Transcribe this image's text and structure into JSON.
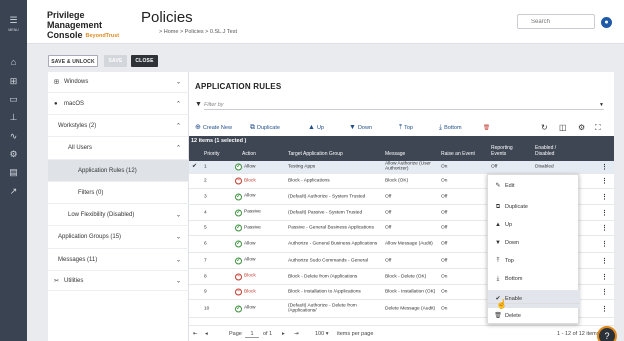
{
  "rail": {
    "menu_label": "MENU",
    "icons": [
      "home-icon",
      "hierarchy-icon",
      "monitor-icon",
      "org-chart-icon",
      "analytics-icon",
      "gears-icon",
      "clipboard-icon",
      "user-link-icon"
    ]
  },
  "header": {
    "brand_line1": "Privilege Management",
    "brand_line2": "Console",
    "brand_badge": "BeyondTrust",
    "title": "Policies",
    "breadcrumb": "> Home > Policies > 0.SL.J Test",
    "search_placeholder": "Search",
    "avatar_icon": "user-icon"
  },
  "toolbar": {
    "save_unlock": "SAVE & UNLOCK",
    "save": "SAVE",
    "close": "CLOSE"
  },
  "sidebar": {
    "items": [
      {
        "label": "Windows",
        "icon": "windows-icon",
        "chev": "⌄"
      },
      {
        "label": "macOS",
        "icon": "apple-icon",
        "chev": "⌃"
      },
      {
        "label": "Workstyles (2)",
        "chev": "⌃"
      },
      {
        "label": "All Users",
        "chev": "⌃"
      },
      {
        "label": "Application Rules (12)",
        "chev": ""
      },
      {
        "label": "Filters (0)",
        "chev": ""
      },
      {
        "label": "Low Flexibility (Disabled)",
        "chev": "⌄"
      },
      {
        "label": "Application Groups (15)",
        "chev": "⌄"
      },
      {
        "label": "Messages (11)",
        "chev": "⌄"
      },
      {
        "label": "Utilities",
        "icon": "tools-icon",
        "chev": "⌄"
      }
    ]
  },
  "main": {
    "title": "APPLICATION RULES",
    "filter_placeholder": "Filter by",
    "actions": {
      "create_new": "Create New",
      "duplicate": "Duplicate",
      "up": "Up",
      "down": "Down",
      "top": "Top",
      "bottom": "Bottom"
    },
    "table": {
      "count": "12 items (1 selected )",
      "columns": [
        "Priority",
        "Action",
        "Target Application Group",
        "Message",
        "Raise an Event",
        "Reporting Events",
        "Enabled / Disabled"
      ],
      "rows": [
        {
          "priority": "1",
          "action": "Allow",
          "target": "Testing Apps",
          "message": "Allow Authorize (User Authorizer)",
          "raise": "On",
          "reporting": "Off",
          "enabled": "Disabled"
        },
        {
          "priority": "2",
          "action": "Block",
          "target": "Block - Applications",
          "message": "Block (OK)",
          "raise": "On",
          "reporting": "",
          "enabled": ""
        },
        {
          "priority": "3",
          "action": "Allow",
          "target": "(Default) Authorize - System Trusted",
          "message": "Off",
          "raise": "Off",
          "reporting": "",
          "enabled": ""
        },
        {
          "priority": "4",
          "action": "Passive",
          "target": "(Default) Passive - System Trusted",
          "message": "Off",
          "raise": "Off",
          "reporting": "",
          "enabled": ""
        },
        {
          "priority": "5",
          "action": "Passive",
          "target": "Passive - General Business Applications",
          "message": "Off",
          "raise": "Off",
          "reporting": "",
          "enabled": ""
        },
        {
          "priority": "6",
          "action": "Allow",
          "target": "Authorize - General Business Applications",
          "message": "Allow Message (Audit)",
          "raise": "Off",
          "reporting": "",
          "enabled": ""
        },
        {
          "priority": "7",
          "action": "Allow",
          "target": "Authorize Sudo Commands - General",
          "message": "Off",
          "raise": "Off",
          "reporting": "",
          "enabled": ""
        },
        {
          "priority": "8",
          "action": "Block",
          "target": "Block - Delete from /Applications",
          "message": "Block - Delete (OK)",
          "raise": "On",
          "reporting": "",
          "enabled": ""
        },
        {
          "priority": "9",
          "action": "Block",
          "target": "Block - Installation to /Applications",
          "message": "Block - Installation (OK)",
          "raise": "On",
          "reporting": "",
          "enabled": ""
        },
        {
          "priority": "10",
          "action": "Allow",
          "target": "(Default) Authorize - Delete from /Applications/",
          "message": "Delete Message (Audit)",
          "raise": "On",
          "reporting": "",
          "enabled": ""
        }
      ]
    },
    "context_menu": [
      "Edit",
      "Duplicate",
      "Up",
      "Down",
      "Top",
      "Bottom",
      "Enable",
      "Delete"
    ],
    "footer": {
      "page_label": "Page",
      "page": "1",
      "of": "of 1",
      "per_page": "100",
      "items_per_page": "items per page",
      "range": "1 - 12 of 12 items"
    }
  },
  "help_icon": "?"
}
